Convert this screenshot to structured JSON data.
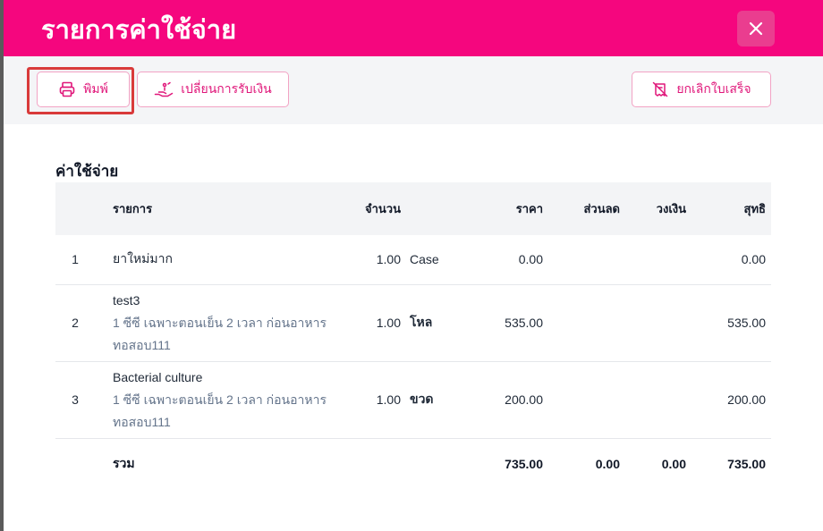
{
  "modal": {
    "title": "รายการค่าใช้จ่าย",
    "close_icon": "close-icon"
  },
  "toolbar": {
    "print_label": "พิมพ์",
    "change_payment_label": "เปลี่ยนการรับเงิน",
    "cancel_receipt_label": "ยกเลิกใบเสร็จ",
    "print_icon": "printer-icon",
    "change_payment_icon": "hand-coins-icon",
    "cancel_receipt_icon": "receipt-off-icon"
  },
  "expenses": {
    "section_title": "ค่าใช้จ่าย",
    "columns": {
      "item": "รายการ",
      "quantity": "จำนวน",
      "price": "ราคา",
      "discount": "ส่วนลด",
      "limit": "วงเงิน",
      "net": "สุทธิ"
    },
    "rows": [
      {
        "index": "1",
        "name": "ยาใหม่มาก",
        "detail": "",
        "note": "",
        "qty": "1.00",
        "unit": "Case",
        "price": "0.00",
        "discount": "",
        "limit": "",
        "net": "0.00"
      },
      {
        "index": "2",
        "name": "test3",
        "detail": "1 ซีซี เฉพาะตอนเย็น 2 เวลา ก่อนอาหาร",
        "note": "ทอสอบ111",
        "qty": "1.00",
        "unit": "โหล",
        "price": "535.00",
        "discount": "",
        "limit": "",
        "net": "535.00"
      },
      {
        "index": "3",
        "name": "Bacterial culture",
        "detail": "1 ซีซี เฉพาะตอนเย็น 2 เวลา ก่อนอาหาร",
        "note": "ทอสอบ111",
        "qty": "1.00",
        "unit": "ขวด",
        "price": "200.00",
        "discount": "",
        "limit": "",
        "net": "200.00"
      }
    ],
    "total": {
      "label": "รวม",
      "price": "735.00",
      "discount": "0.00",
      "limit": "0.00",
      "net": "735.00"
    }
  },
  "colors": {
    "header": "#f5067e",
    "accent": "#e0177a",
    "discount_total": "#e02424"
  }
}
